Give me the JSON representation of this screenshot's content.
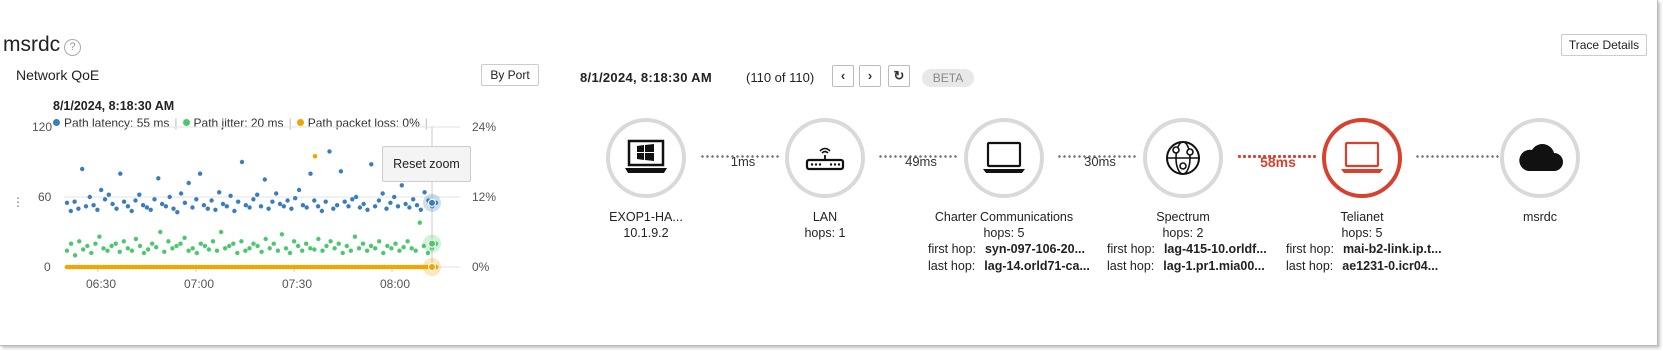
{
  "app": {
    "title": "msrdc",
    "help": "?"
  },
  "left_panel": {
    "title": "Network QoE",
    "by_port_label": "By Port",
    "timestamp": "8/1/2024, 8:18:30 AM",
    "legend": [
      {
        "label": "Path latency: 55 ms",
        "color": "#3a7dbf"
      },
      {
        "label": "Path jitter: 20 ms",
        "color": "#4cc76c"
      },
      {
        "label": "Path packet loss: 0%",
        "color": "#f0a500"
      }
    ],
    "legend_sep": "|",
    "reset_zoom_label": "Reset zoom",
    "y_left_ticks": [
      "120",
      "60",
      "0"
    ],
    "y_right_ticks": [
      "24%",
      "12%",
      "0%"
    ],
    "x_ticks": [
      "06:30",
      "07:00",
      "07:30",
      "08:00"
    ],
    "handle_glyph": "⋮"
  },
  "chart_data": {
    "type": "scatter",
    "x_ticks": [
      "06:30",
      "07:00",
      "07:30",
      "08:00"
    ],
    "ylim_left": [
      0,
      120
    ],
    "ylim_right": [
      "0%",
      "24%"
    ],
    "grid": true,
    "series": [
      {
        "name": "Path latency",
        "axis": "left",
        "color": "#3a7dbf",
        "values": [
          55,
          48,
          56,
          50,
          84,
          52,
          60,
          53,
          49,
          66,
          58,
          62,
          54,
          50,
          80,
          56,
          52,
          48,
          57,
          62,
          53,
          51,
          49,
          58,
          76,
          54,
          52,
          60,
          50,
          47,
          63,
          55,
          72,
          51,
          58,
          80,
          53,
          50,
          57,
          49,
          64,
          54,
          52,
          61,
          48,
          56,
          90,
          53,
          51,
          58,
          62,
          52,
          75,
          50,
          56,
          63,
          54,
          52,
          57,
          50,
          59,
          66,
          53,
          51,
          80,
          57,
          52,
          48,
          56,
          99,
          50,
          53,
          82,
          56,
          52,
          58,
          60,
          51,
          54,
          49,
          88,
          52,
          57,
          63,
          50,
          55,
          60,
          52,
          70,
          54,
          51,
          58,
          53,
          49,
          64,
          57,
          52,
          55
        ]
      },
      {
        "name": "Path jitter",
        "axis": "left",
        "color": "#4cc76c",
        "values": [
          14,
          20,
          10,
          22,
          15,
          18,
          12,
          20,
          26,
          16,
          14,
          18,
          20,
          13,
          22,
          16,
          14,
          24,
          18,
          12,
          15,
          20,
          17,
          30,
          13,
          22,
          16,
          18,
          20,
          25,
          14,
          16,
          12,
          20,
          18,
          15,
          22,
          14,
          30,
          16,
          18,
          20,
          12,
          22,
          14,
          16,
          20,
          18,
          13,
          24,
          16,
          20,
          14,
          28,
          16,
          12,
          22,
          18,
          14,
          20,
          16,
          15,
          24,
          14,
          18,
          22,
          16,
          20,
          12,
          18,
          14,
          26,
          16,
          20,
          14,
          18,
          16,
          22,
          12,
          18,
          16,
          20,
          14,
          17,
          22,
          16,
          14,
          38,
          18,
          12,
          16,
          20
        ]
      },
      {
        "name": "Path packet loss",
        "axis": "right",
        "values_pct": [
          0,
          0,
          0,
          0,
          0,
          0,
          0,
          0,
          0,
          0,
          0,
          0,
          0,
          0,
          0,
          0,
          0,
          0,
          0,
          0,
          0,
          0,
          0,
          0,
          0,
          0,
          0,
          0,
          0,
          0,
          0,
          0,
          0,
          0,
          0,
          0,
          0,
          0,
          0,
          0,
          0,
          0,
          0,
          0,
          0,
          0,
          0,
          0,
          0,
          0,
          0,
          0,
          0,
          0,
          0,
          0,
          0,
          0,
          0,
          0,
          0,
          0,
          0,
          0,
          0,
          0,
          0,
          0,
          0,
          0,
          0,
          0,
          0,
          0,
          0,
          0,
          0,
          0,
          0,
          0,
          0,
          0,
          0,
          0,
          0,
          0,
          0,
          0,
          0,
          0,
          0,
          0,
          0,
          0,
          0,
          0,
          0,
          0,
          0,
          0,
          0,
          0,
          0,
          0,
          0,
          0,
          0,
          0,
          0,
          0,
          0,
          0,
          0,
          0,
          0,
          0,
          0,
          0,
          0,
          0,
          0,
          0,
          0,
          0
        ],
        "color": "#f0a500",
        "outlier_latency_scale": 95
      }
    ],
    "hover": {
      "time": "8/1/2024, 8:18:30 AM",
      "latency": 55,
      "jitter": 20,
      "packet_loss_pct": 0
    }
  },
  "trace": {
    "timestamp": "8/1/2024, 8:18:30 AM",
    "count": "(110 of 110)",
    "prev_icon": "‹",
    "next_icon": "›",
    "refresh_icon": "↻",
    "beta_label": "BETA",
    "trace_details_label": "Trace Details",
    "nodes": [
      {
        "name": "EXOP1-HA...",
        "sub": "10.1.9.2",
        "icon": "windows-laptop-icon"
      },
      {
        "name": "LAN",
        "sub": "hops: 1",
        "icon": "router-icon"
      },
      {
        "name": "Charter Communications",
        "sub": "hops: 5",
        "icon": "laptop-icon",
        "first_hop": "syn-097-106-20...",
        "last_hop": "lag-14.orld71-ca..."
      },
      {
        "name": "Spectrum",
        "sub": "hops: 2",
        "icon": "globe-network-icon",
        "first_hop": "lag-415-10.orldf...",
        "last_hop": "lag-1.pr1.mia00..."
      },
      {
        "name": "Telianet",
        "sub": "hops: 5",
        "icon": "laptop-icon",
        "alert": true,
        "first_hop": "mai-b2-link.ip.t...",
        "last_hop": "ae1231-0.icr04..."
      },
      {
        "name": "msrdc",
        "sub": "",
        "icon": "cloud-icon"
      }
    ],
    "links": [
      {
        "latency": "1ms",
        "alert": false
      },
      {
        "latency": "49ms",
        "alert": false
      },
      {
        "latency": "30ms",
        "alert": false
      },
      {
        "latency": "58ms",
        "alert": true
      },
      {
        "latency": "",
        "alert": false
      }
    ],
    "first_hop_label": "first hop:",
    "last_hop_label": "last hop:"
  }
}
